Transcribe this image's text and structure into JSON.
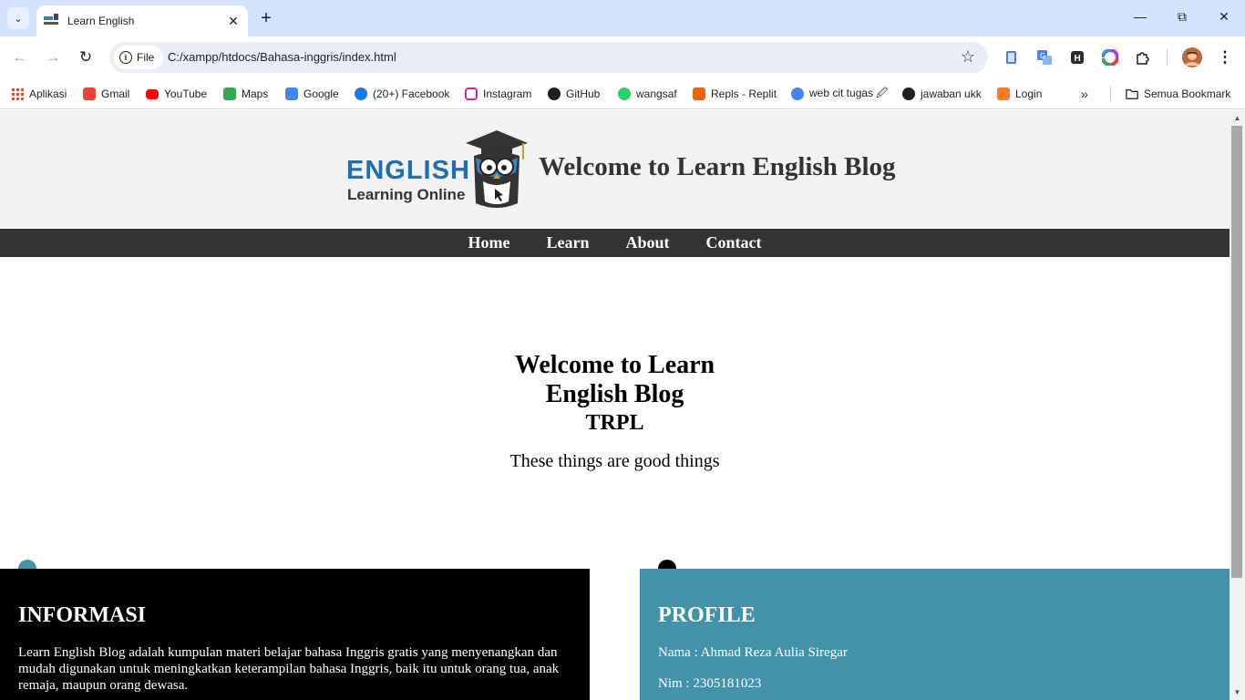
{
  "browser": {
    "tab_title": "Learn English",
    "url_chip": "File",
    "url": "C:/xampp/htdocs/Bahasa-inggris/index.html",
    "bookmarks": [
      {
        "label": "Aplikasi",
        "icon": "apps-grid-icon",
        "color": "#ea4335"
      },
      {
        "label": "Gmail",
        "icon": "gmail-icon",
        "color": "#ea4335"
      },
      {
        "label": "YouTube",
        "icon": "youtube-icon",
        "color": "#ff0000"
      },
      {
        "label": "Maps",
        "icon": "maps-pin-icon",
        "color": "#34a853"
      },
      {
        "label": "Google",
        "icon": "google-icon",
        "color": "#4285f4"
      },
      {
        "label": "(20+) Facebook",
        "icon": "facebook-icon",
        "color": "#1877f2"
      },
      {
        "label": "Instagram",
        "icon": "instagram-icon",
        "color": "#d6249f"
      },
      {
        "label": "GitHub",
        "icon": "github-icon",
        "color": "#1f1f1f"
      },
      {
        "label": "wangsaf",
        "icon": "whatsapp-icon",
        "color": "#25d366"
      },
      {
        "label": "Repls - Replit",
        "icon": "replit-icon",
        "color": "#f26207"
      },
      {
        "label": "web cit tugas 🖉",
        "icon": "chrome-icon",
        "color": "#4285f4"
      },
      {
        "label": "jawaban ukk",
        "icon": "github-icon",
        "color": "#1f1f1f"
      },
      {
        "label": "Login",
        "icon": "xampp-icon",
        "color": "#fb7a24"
      }
    ],
    "all_bookmarks": "Semua Bookmark"
  },
  "site": {
    "logo_text": "ENGLISH",
    "logo_sub": "Learning Online",
    "header_title": "Welcome to Learn English Blog",
    "nav": [
      "Home",
      "Learn",
      "About",
      "Contact"
    ],
    "hero_title": "Welcome to Learn English Blog",
    "hero_subtitle": "TRPL",
    "hero_text": "These things are good things",
    "info": {
      "title": "INFORMASI",
      "text": "Learn English Blog adalah kumpulan materi belajar bahasa Inggris gratis yang menyenangkan dan mudah digunakan untuk meningkatkan keterampilan bahasa Inggris, baik itu untuk orang tua, anak remaja, maupun orang dewasa.",
      "dot_color": "#4492aa",
      "bg": "#000000"
    },
    "profile": {
      "title": "PROFILE",
      "name_line": "Nama : Ahmad Reza Aulia Siregar",
      "nim_line": "Nim : 2305181023",
      "dot_color": "#000000",
      "bg": "#4492aa"
    }
  }
}
